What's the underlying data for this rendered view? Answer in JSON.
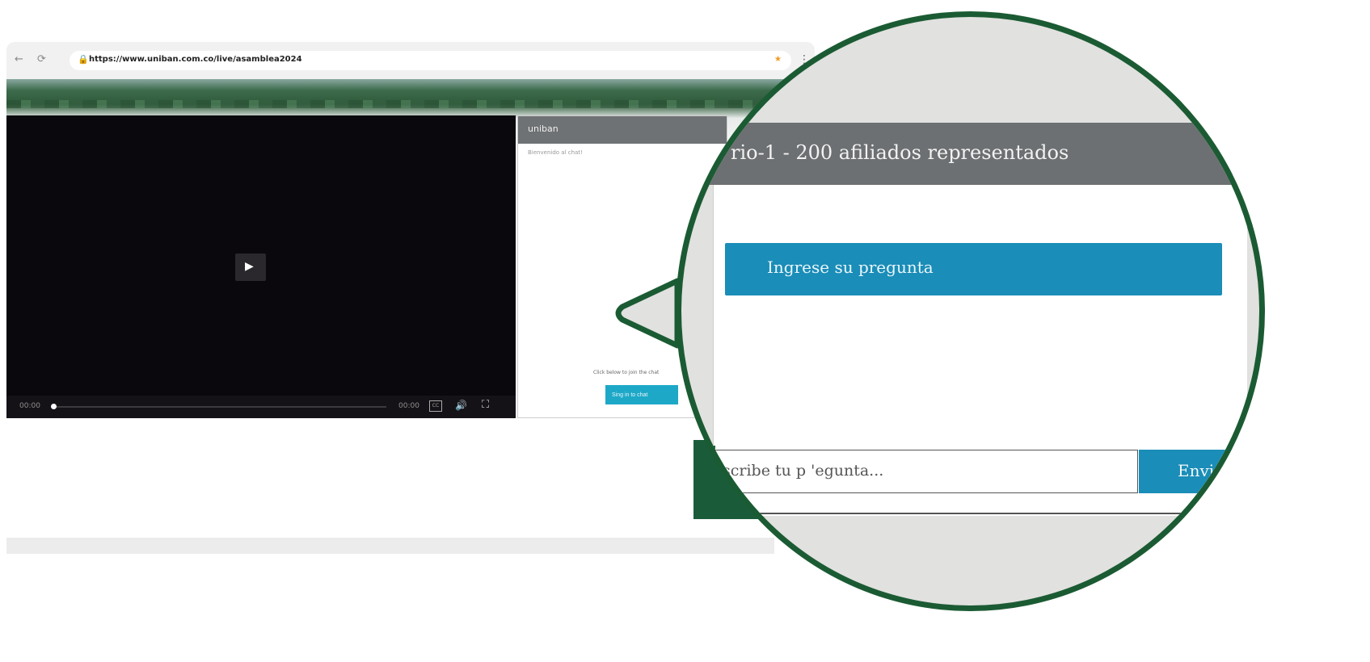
{
  "browser": {
    "url": "https://www.uniban.com.co/live/asamblea2024",
    "nav_back": "←",
    "nav_reload": "⟳",
    "lock": "🔒",
    "star": "★",
    "menu": "⋮"
  },
  "video": {
    "play": "▶",
    "time_current": "00:00",
    "time_total": "00:00",
    "cc_label": "CC",
    "volume_icon": "🔊",
    "fullscreen_icon": "⛶",
    "progress": 0
  },
  "chat": {
    "title": "uniban",
    "welcome": "Bienvenido al chat!",
    "hint": "Click below to join the chat",
    "signin_label": "Sing in to chat"
  },
  "zoom": {
    "title": "rio-1 - 200 afiliados representados",
    "ask_label": "Ingrese su pregunta",
    "input_placeholder": "scribe tu p 'egunta...",
    "send_label": "Enviar"
  },
  "colors": {
    "accent_blue": "#1a8db8",
    "header_gray": "#6d7072",
    "ring_green": "#1b5b33"
  }
}
